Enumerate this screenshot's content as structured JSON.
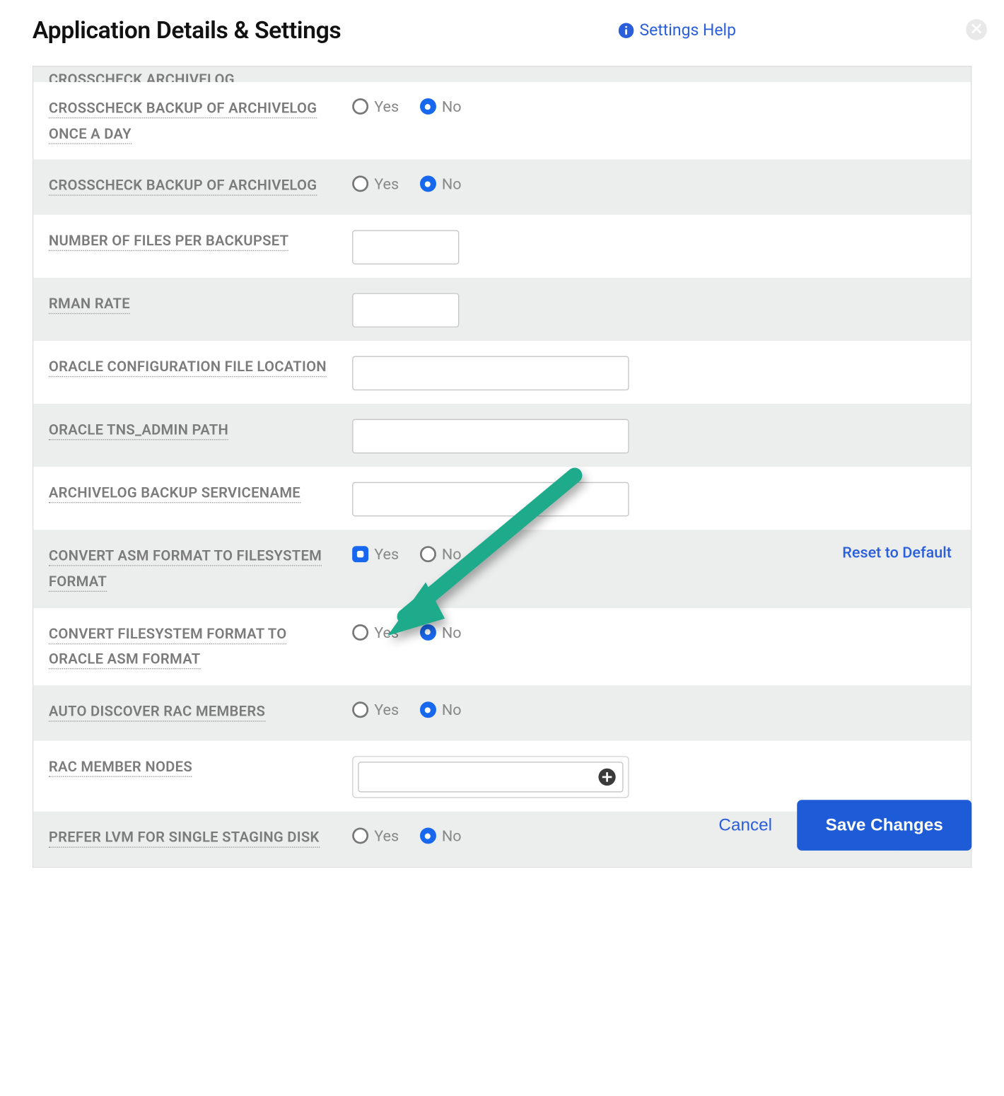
{
  "header": {
    "title": "Application Details & Settings",
    "help_label": "Settings Help"
  },
  "labels": {
    "yes": "Yes",
    "no": "No",
    "reset": "Reset to Default",
    "cancel": "Cancel",
    "save": "Save Changes"
  },
  "rows": [
    {
      "id": "crosscheck-archivelog",
      "label": "CROSSCHECK ARCHIVELOG",
      "type": "radio",
      "selected": "no",
      "alt": true,
      "clip": true
    },
    {
      "id": "crosscheck-backup-of-archivelog-once-a-day",
      "label": "CROSSCHECK BACKUP OF ARCHIVELOG ONCE A DAY",
      "type": "radio",
      "selected": "no",
      "alt": false
    },
    {
      "id": "crosscheck-backup-of-archivelog",
      "label": "CROSSCHECK BACKUP OF ARCHIVELOG",
      "type": "radio",
      "selected": "no",
      "alt": true
    },
    {
      "id": "number-of-files-per-backupset",
      "label": "NUMBER OF FILES PER BACKUPSET",
      "type": "text-small",
      "value": "",
      "alt": false
    },
    {
      "id": "rman-rate",
      "label": "RMAN RATE",
      "type": "text-small",
      "value": "",
      "alt": true
    },
    {
      "id": "oracle-configuration-file-location",
      "label": "ORACLE CONFIGURATION FILE LOCATION",
      "type": "text-wide",
      "value": "",
      "alt": false
    },
    {
      "id": "oracle-tns-admin-path",
      "label": "ORACLE TNS_ADMIN PATH",
      "type": "text-wide",
      "value": "",
      "alt": true
    },
    {
      "id": "archivelog-backup-servicename",
      "label": "ARCHIVELOG BACKUP SERVICENAME",
      "type": "text-wide",
      "value": "",
      "alt": false
    },
    {
      "id": "convert-asm-format-to-filesystem-format",
      "label": "CONVERT ASM FORMAT TO FILESYSTEM FORMAT",
      "type": "radio",
      "selected": "yes",
      "alt": true,
      "reset": true,
      "square": true
    },
    {
      "id": "convert-filesystem-format-to-oracle-asm-format",
      "label": "CONVERT FILESYSTEM FORMAT TO ORACLE ASM FORMAT",
      "type": "radio",
      "selected": "no",
      "alt": false
    },
    {
      "id": "auto-discover-rac-members",
      "label": "AUTO DISCOVER RAC MEMBERS",
      "type": "radio",
      "selected": "no",
      "alt": true
    },
    {
      "id": "rac-member-nodes",
      "label": "RAC MEMBER NODES",
      "type": "rac",
      "value": "",
      "alt": false
    },
    {
      "id": "prefer-lvm-for-single-staging-disk",
      "label": "PREFER LVM FOR SINGLE STAGING DISK",
      "type": "radio",
      "selected": "no",
      "alt": true
    }
  ]
}
